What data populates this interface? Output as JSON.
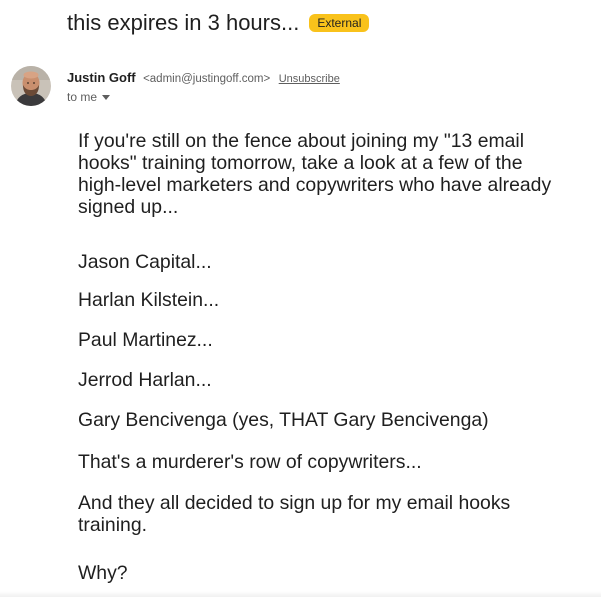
{
  "email": {
    "subject": "this expires in 3 hours...",
    "label": "External",
    "sender": {
      "name": "Justin Goff",
      "email": "<admin@justingoff.com>",
      "unsubscribe": "Unsubscribe"
    },
    "recipient": "to me",
    "body": [
      "If you're still on the fence about joining my \"13 email hooks\" training tomorrow, take a look at a few of the high-level marketers and copywriters who have already signed up...",
      "Jason Capital...",
      "Harlan Kilstein...",
      "Paul Martinez...",
      "Jerrod Harlan...",
      "Gary Bencivenga (yes, THAT Gary Bencivenga)",
      "That's a murderer's row of copywriters...",
      "And they all decided to sign up for my email hooks training.",
      "Why?"
    ]
  },
  "colors": {
    "label_bg": "#f9c21b",
    "text": "#1f1f1f",
    "muted": "#5e5e5e"
  },
  "icons": {
    "avatar": "sender-avatar-photo",
    "dropdown": "chevron-down-icon"
  }
}
